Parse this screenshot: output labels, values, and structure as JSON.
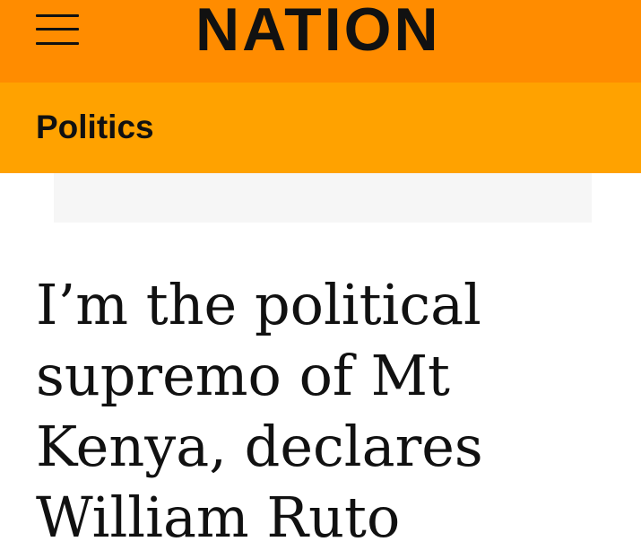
{
  "header": {
    "menu_icon": "hamburger-menu-icon",
    "logo_text": "NATION",
    "background_color": "#ff8c00"
  },
  "section": {
    "label": "Politics",
    "background_color": "#ffa200"
  },
  "article": {
    "headline": "I’m the political supremo of Mt Kenya, declares William Ruto"
  }
}
